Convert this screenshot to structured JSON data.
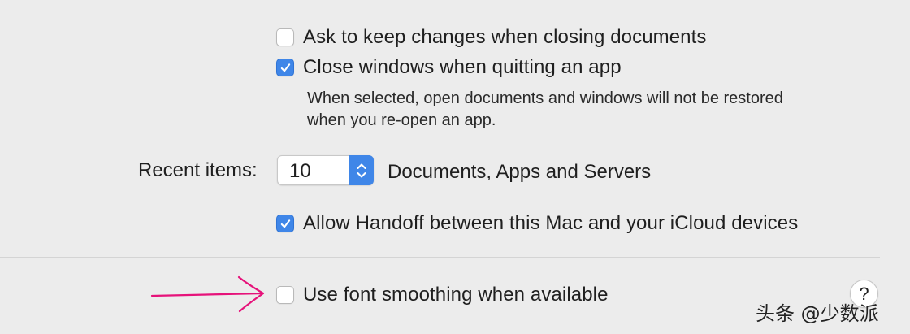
{
  "options": {
    "ask_keep_changes": {
      "label": "Ask to keep changes when closing documents",
      "checked": false
    },
    "close_windows": {
      "label": "Close windows when quitting an app",
      "checked": true
    },
    "close_windows_help": {
      "line1": "When selected, open documents and windows will not be restored",
      "line2": "when you re-open an app."
    },
    "allow_handoff": {
      "label": "Allow Handoff between this Mac and your iCloud devices",
      "checked": true
    },
    "font_smoothing": {
      "label": "Use font smoothing when available",
      "checked": false
    }
  },
  "recent_items": {
    "label": "Recent items:",
    "value": "10",
    "suffix": "Documents, Apps and Servers"
  },
  "help_button": {
    "label": "?"
  },
  "watermark": {
    "text": "头条 @少数派"
  },
  "colors": {
    "accent": "#3f86e8",
    "annotation_arrow": "#e6127a",
    "background": "#ececec"
  },
  "icons": {
    "check": "checkmark-icon",
    "stepper": "up-down-chevron-icon",
    "annotation": "arrow-right-icon"
  }
}
